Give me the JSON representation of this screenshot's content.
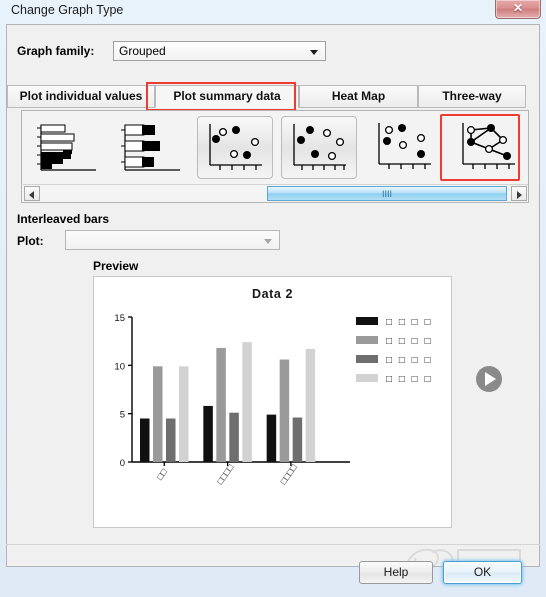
{
  "window": {
    "title": "Change Graph Type",
    "close_icon": "close-x-icon"
  },
  "graph_family": {
    "label": "Graph family:",
    "value": "Grouped",
    "options": [
      "Grouped"
    ],
    "dropdown_icon": "chevron-down-icon"
  },
  "tabs": [
    {
      "label": "Plot individual values",
      "selected": false
    },
    {
      "label": "Plot summary data",
      "selected": true
    },
    {
      "label": "Heat Map",
      "selected": false
    },
    {
      "label": "Three-way",
      "selected": false
    }
  ],
  "gallery": {
    "icons": [
      {
        "name": "stacked-horizontal-bar-icon",
        "selected": false,
        "framed": false
      },
      {
        "name": "grouped-horizontal-bar-icon",
        "selected": false,
        "framed": false
      },
      {
        "name": "scatter-plot-icon-1",
        "selected": false,
        "framed": true
      },
      {
        "name": "scatter-plot-icon-2",
        "selected": false,
        "framed": true
      },
      {
        "name": "scatter-plot-icon-3",
        "selected": false,
        "framed": false
      },
      {
        "name": "connected-scatter-icon",
        "selected": true,
        "framed": false
      }
    ],
    "scrollbar": {
      "left_icon": "arrow-left-icon",
      "right_icon": "arrow-right-icon",
      "grip": "IIII"
    }
  },
  "section": {
    "title": "Interleaved bars",
    "plot_label": "Plot:",
    "plot_value": "",
    "plot_dropdown_icon": "chevron-down-icon"
  },
  "preview": {
    "label": "Preview",
    "play_icon": "play-icon"
  },
  "footer": {
    "help_label": "Help",
    "ok_label": "OK"
  },
  "chart_data": {
    "type": "bar",
    "title": "Data 2",
    "xlabel": "",
    "ylabel": "",
    "ylim": [
      0,
      15
    ],
    "yticks": [
      0,
      5,
      10,
      15
    ],
    "grid": false,
    "legend_position": "right",
    "categories": [
      "□□",
      "□□□□",
      "□□□□"
    ],
    "series": [
      {
        "name": "□ □ □ □",
        "color": "#101010",
        "values": [
          4.5,
          5.8,
          4.9
        ]
      },
      {
        "name": "□ □ □ □",
        "color": "#9a9a9a",
        "values": [
          9.9,
          11.8,
          10.6
        ]
      },
      {
        "name": "□ □ □ □",
        "color": "#6e6e6e",
        "values": [
          4.5,
          5.1,
          4.6
        ]
      },
      {
        "name": "□ □ □ □",
        "color": "#d2d2d2",
        "values": [
          9.9,
          12.4,
          11.7
        ]
      }
    ]
  }
}
